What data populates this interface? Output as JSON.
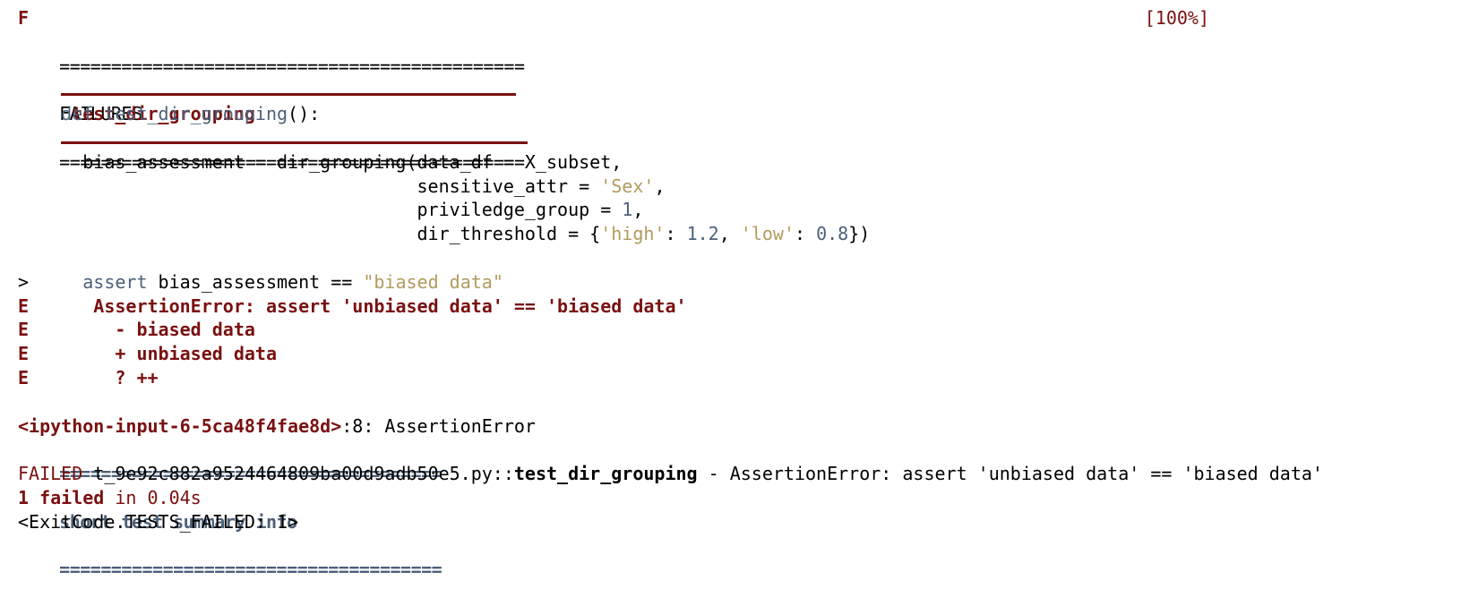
{
  "progress": {
    "status_char": "F",
    "percent": "[100%]"
  },
  "failures_header": {
    "left_rule": "=============================================",
    "title": "FAILURES",
    "right_rule": "============================================="
  },
  "test_header": {
    "name": "test_dir_grouping"
  },
  "code": {
    "def_kw": "def",
    "func_name": "test_dir_grouping",
    "func_sig_tail": "():",
    "line1_pre": "      bias_assessment = dir_grouping(data_df = X_subset,",
    "line2_pre": "                                     sensitive_attr = ",
    "line2_str": "'Sex'",
    "line2_post": ",",
    "line3_pre": "                                     priviledge_group = ",
    "line3_num": "1",
    "line3_post": ",",
    "line4_pre": "                                     dir_threshold = {",
    "line4_str1": "'high'",
    "line4_mid1": ": ",
    "line4_num1": "1.2",
    "line4_mid2": ", ",
    "line4_str2": "'low'",
    "line4_mid3": ": ",
    "line4_num2": "0.8",
    "line4_post": "})"
  },
  "assertion": {
    "marker": ">",
    "kw": "assert",
    "expr": " bias_assessment == ",
    "expected": "\"biased data\""
  },
  "errors": [
    {
      "marker": "E",
      "text": "      AssertionError: assert 'unbiased data' == 'biased data'"
    },
    {
      "marker": "E",
      "text": "        - biased data"
    },
    {
      "marker": "E",
      "text": "        + unbiased data"
    },
    {
      "marker": "E",
      "text": "        ? ++"
    }
  ],
  "location": {
    "file": "<ipython-input-6-5ca48f4fae8d>",
    "rest": ":8: AssertionError"
  },
  "summary_header": {
    "left_rule": "=====================================",
    "title": "short test summary info",
    "right_rule": "====================================="
  },
  "summary": {
    "failed_label": "FAILED",
    "path": " t_9e92c882a9524464809ba00d9adb50e5.py::",
    "test": "test_dir_grouping",
    "message": " - AssertionError: assert 'unbiased data' == 'biased data'"
  },
  "result": {
    "failed_count": "1 failed",
    "time": " in 0.04s"
  },
  "exit_code": "<ExitCode.TESTS_FAILED: 1>"
}
